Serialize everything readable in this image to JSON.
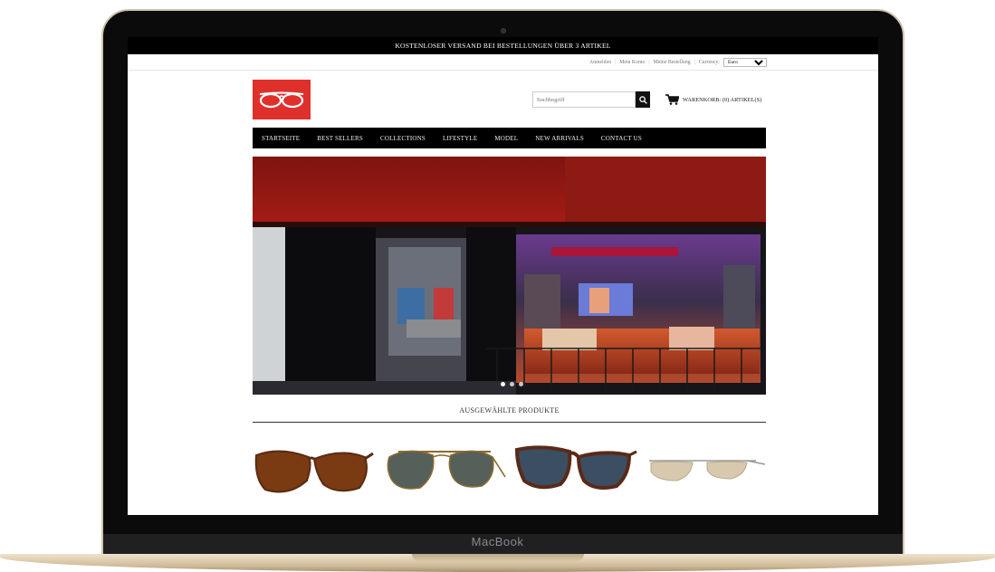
{
  "device": {
    "brand": "MacBook"
  },
  "promo_bar": {
    "text": "KOSTENLOSER VERSAND BEI BESTELLUNGEN ÜBER 3 ARTIKEL"
  },
  "utility_nav": {
    "links": [
      "Anmelden",
      "Mein Konto",
      "Meine Bestellung"
    ],
    "currency_label": "Currency:",
    "currency_value": "Euro"
  },
  "header": {
    "logo_icon": "glasses-logo",
    "search_placeholder": "Suchbegriff",
    "cart_label": "WARENKORB: (0) ARTIKEL(S)"
  },
  "main_nav": [
    "STARTSEITE",
    "BEST SELLERS",
    "COLLECTIONS",
    "LIFESTYLE",
    "MODEL",
    "NEW ARRIVALS",
    "CONTACT US"
  ],
  "hero": {
    "image": "storefront-photo",
    "slide_count": 3,
    "active_slide": 1
  },
  "featured": {
    "title": "AUSGEWÄHLTE PRODUKTE"
  },
  "products": [
    {
      "image": "brown-wrap-sunglasses"
    },
    {
      "image": "aviator-gradient-sunglasses"
    },
    {
      "image": "tortoise-wayfarer-sunglasses"
    },
    {
      "image": "rimless-silver-sunglasses"
    }
  ],
  "colors": {
    "accent_red": "#e0302b",
    "nav_bg": "#000000"
  }
}
